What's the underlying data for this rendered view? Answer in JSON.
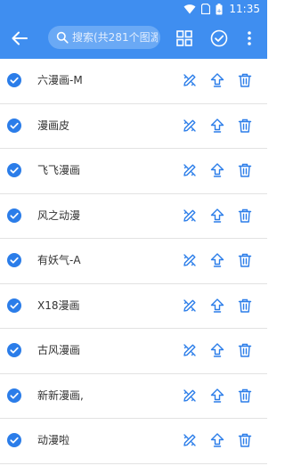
{
  "status_bar": {
    "time": "11:35",
    "icons": [
      "wifi-icon",
      "sim-icon",
      "battery-icon"
    ]
  },
  "toolbar": {
    "back_icon": "arrow-left-icon",
    "search_placeholder": "搜索(共281个图源)",
    "search_value": "",
    "grid_icon": "grid-icon",
    "select_all_icon": "check-circle-icon",
    "more_icon": "more-vert-icon"
  },
  "sources": [
    {
      "name": "六漫画-M",
      "checked": true
    },
    {
      "name": "漫画皮",
      "checked": true
    },
    {
      "name": "飞飞漫画",
      "checked": true
    },
    {
      "name": "风之动漫",
      "checked": true
    },
    {
      "name": "有妖气-A",
      "checked": true
    },
    {
      "name": "X18漫画",
      "checked": true
    },
    {
      "name": "古风漫画",
      "checked": true
    },
    {
      "name": "新新漫画,",
      "checked": true
    },
    {
      "name": "动漫啦",
      "checked": true
    }
  ],
  "row_actions": {
    "edit_icon": "edit-icon",
    "top_icon": "move-to-top-icon",
    "delete_icon": "delete-icon"
  },
  "colors": {
    "primary": "#3f8ef0",
    "accent": "#2b7de9",
    "text": "#333333",
    "divider": "#e2e2e2"
  }
}
